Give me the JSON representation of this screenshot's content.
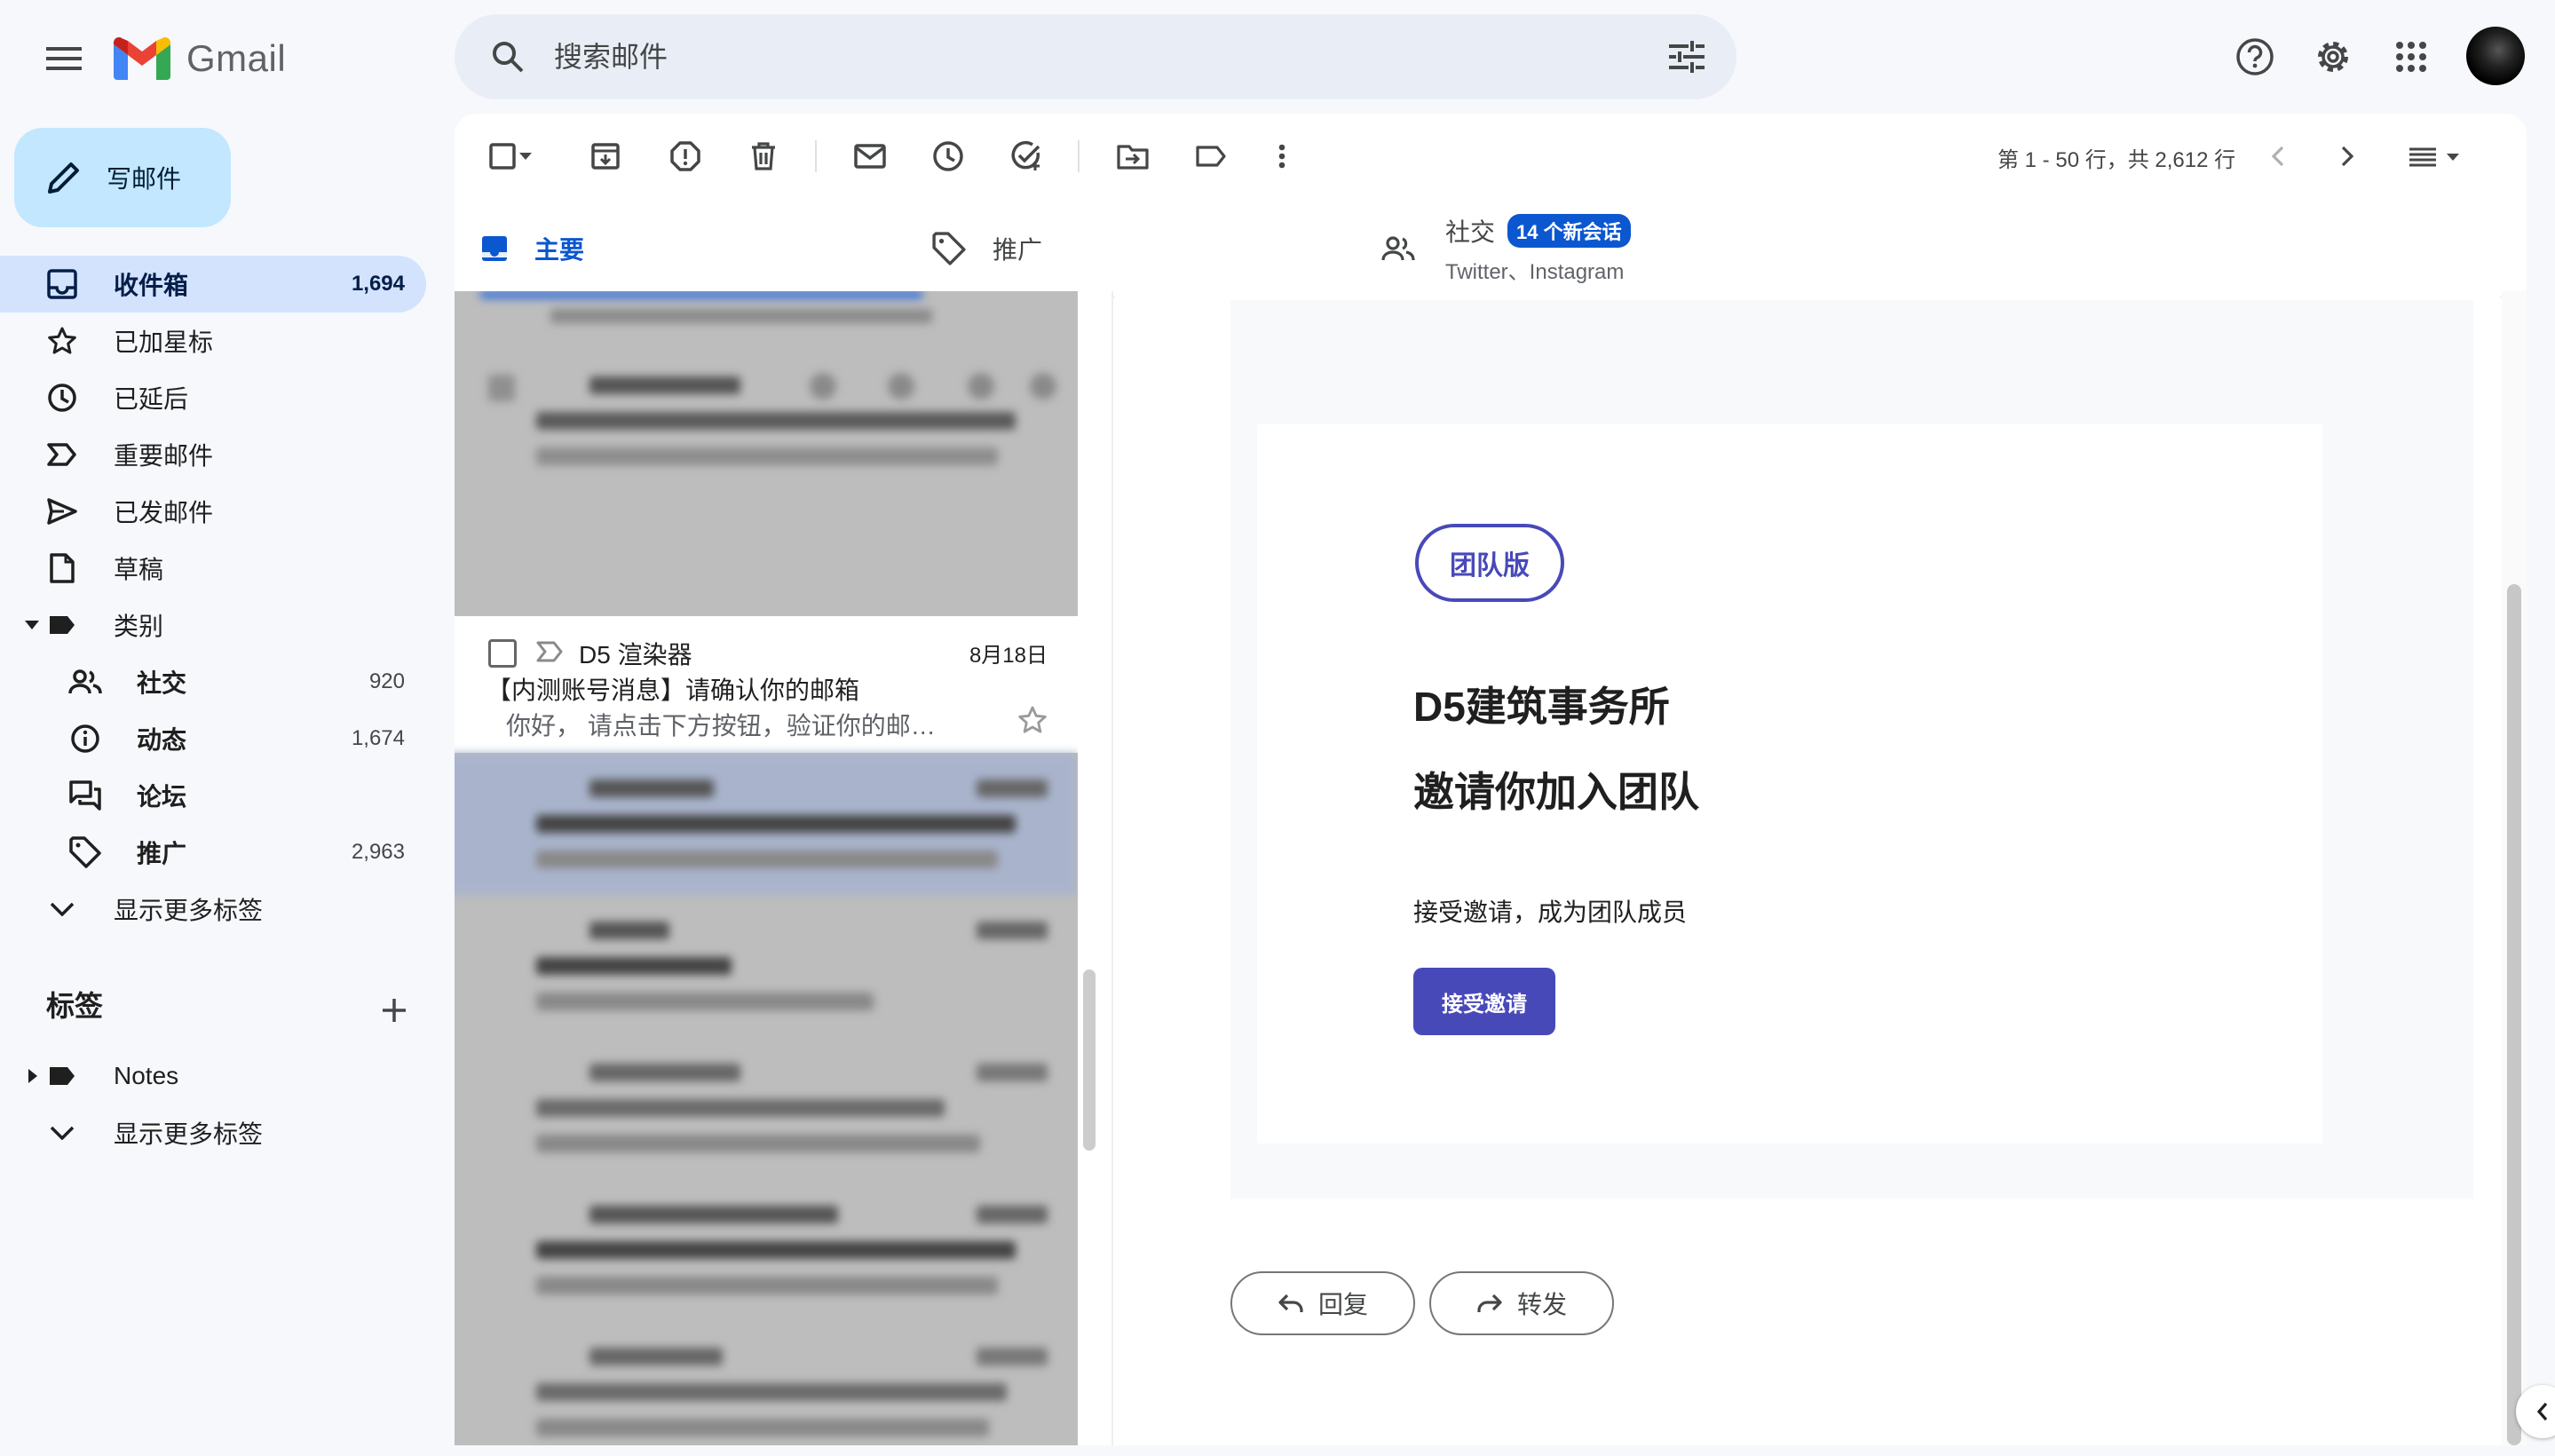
{
  "app": {
    "name": "Gmail"
  },
  "search": {
    "placeholder": "搜索邮件"
  },
  "compose": {
    "label": "写邮件"
  },
  "sidebar": {
    "items": [
      {
        "label": "收件箱",
        "count": "1,694"
      },
      {
        "label": "已加星标",
        "count": ""
      },
      {
        "label": "已延后",
        "count": ""
      },
      {
        "label": "重要邮件",
        "count": ""
      },
      {
        "label": "已发邮件",
        "count": ""
      },
      {
        "label": "草稿",
        "count": ""
      },
      {
        "label": "类别",
        "count": ""
      }
    ],
    "categories": [
      {
        "label": "社交",
        "count": "920"
      },
      {
        "label": "动态",
        "count": "1,674"
      },
      {
        "label": "论坛",
        "count": ""
      },
      {
        "label": "推广",
        "count": "2,963"
      }
    ],
    "more_label": "显示更多标签",
    "labels_heading": "标签",
    "labels": [
      {
        "label": "Notes"
      }
    ],
    "more_label_2": "显示更多标签"
  },
  "toolbar": {
    "pager": "第 1 - 50 行，共 2,612 行"
  },
  "tabs": {
    "primary": "主要",
    "promotions": "推广",
    "social": "社交",
    "social_badge": "14 个新会话",
    "social_sub": "Twitter、Instagram"
  },
  "mail_list": {
    "focused": {
      "sender": "D5 渲染器",
      "date": "8月18日",
      "subject": "【内测账号消息】请确认你的邮箱",
      "snippet": "你好， 请点击下方按钮，验证你的邮箱..."
    }
  },
  "email": {
    "badge": "团队版",
    "team_name": "D5建筑事务所",
    "title": "邀请你加入团队",
    "description": "接受邀请，成为团队成员",
    "accept_label": "接受邀请"
  },
  "actions": {
    "reply": "回复",
    "forward": "转发"
  },
  "colors": {
    "accent": "#0b57d0",
    "invite": "#4849b9",
    "compose_bg": "#c2e7ff",
    "active_nav": "#d3e3fd"
  }
}
